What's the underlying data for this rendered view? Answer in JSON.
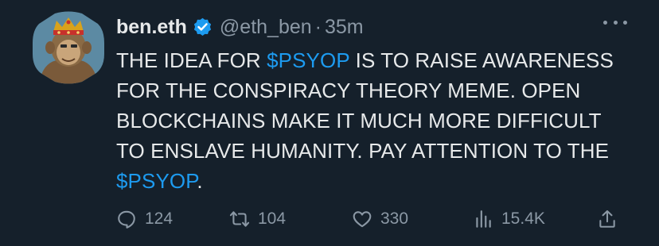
{
  "tweet": {
    "author": {
      "display_name": "ben.eth",
      "handle": "@eth_ben",
      "separator": "·",
      "time": "35m",
      "verified": true,
      "avatar_icon": "bored-ape-crown-avatar"
    },
    "text": {
      "part1": "THE IDEA FOR ",
      "cashtag1": "$PSYOP",
      "part2": " IS TO RAISE AWARENESS FOR THE CONSPIRACY THEORY MEME. OPEN BLOCKCHAINS MAKE IT MUCH MORE DIFFICULT TO ENSLAVE HUMANITY. PAY ATTENTION TO THE ",
      "cashtag2": "$PSYOP",
      "part3": "."
    },
    "actions": {
      "replies": "124",
      "retweets": "104",
      "likes": "330",
      "views": "15.4K"
    }
  },
  "colors": {
    "background": "#15202b",
    "text": "#e7e9ea",
    "muted": "#8b98a5",
    "accent": "#1d9bf0"
  }
}
